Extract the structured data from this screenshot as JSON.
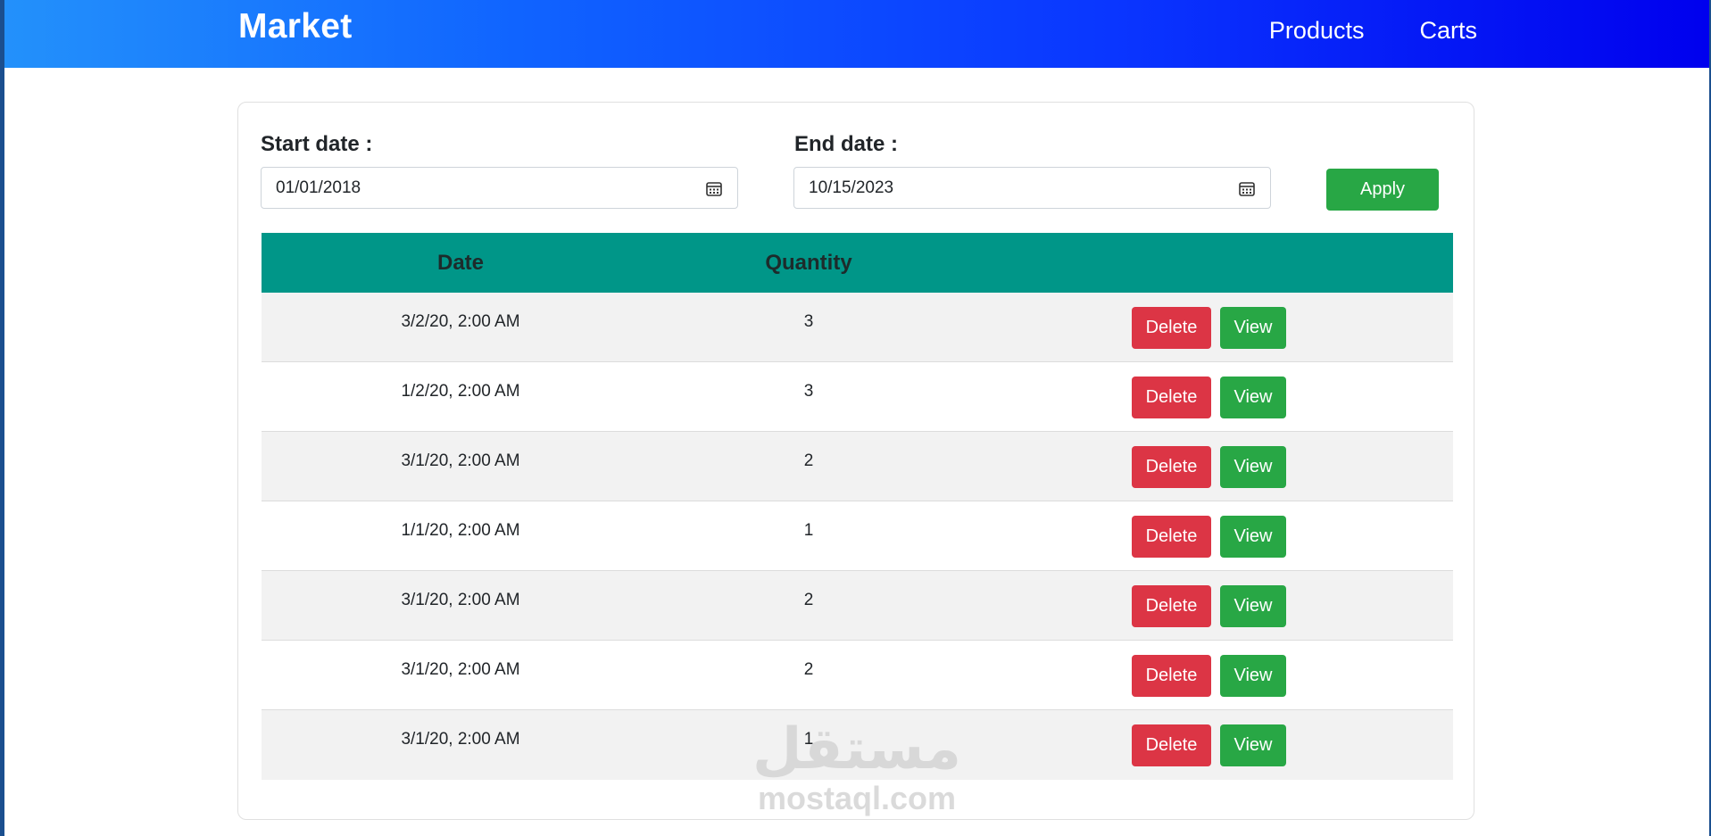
{
  "navbar": {
    "brand": "Market",
    "links": [
      "Products",
      "Carts"
    ]
  },
  "filters": {
    "start_label": "Start date :",
    "start_value": "01/01/2018",
    "end_label": "End date :",
    "end_value": "10/15/2023",
    "apply_label": "Apply"
  },
  "table": {
    "headers": [
      "Date",
      "Quantity"
    ],
    "rows": [
      {
        "date": "3/2/20, 2:00 AM",
        "quantity": "3"
      },
      {
        "date": "1/2/20, 2:00 AM",
        "quantity": "3"
      },
      {
        "date": "3/1/20, 2:00 AM",
        "quantity": "2"
      },
      {
        "date": "1/1/20, 2:00 AM",
        "quantity": "1"
      },
      {
        "date": "3/1/20, 2:00 AM",
        "quantity": "2"
      },
      {
        "date": "3/1/20, 2:00 AM",
        "quantity": "2"
      },
      {
        "date": "3/1/20, 2:00 AM",
        "quantity": "1"
      }
    ],
    "delete_label": "Delete",
    "view_label": "View"
  },
  "watermark": {
    "arabic": "مستقل",
    "latin": "mostaql.com"
  },
  "colors": {
    "header_teal": "#009688",
    "delete_red": "#dc3545",
    "view_green": "#28a745"
  },
  "icons": {
    "date_picker": "calendar-icon"
  }
}
